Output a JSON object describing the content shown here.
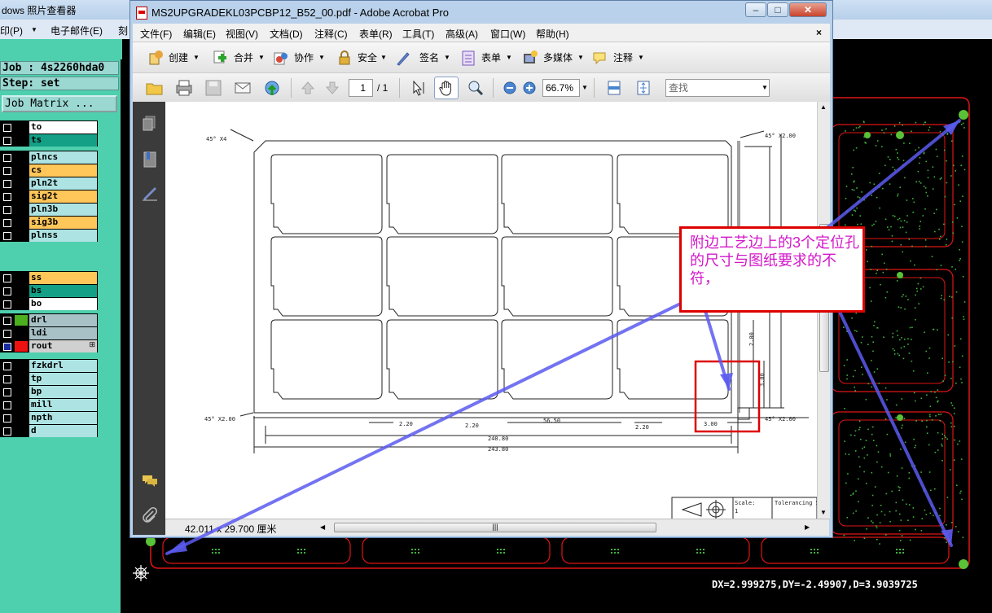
{
  "photo_viewer": {
    "title": "dows 照片查看器",
    "menu": [
      {
        "label": "打印(P)",
        "display": "印(P)"
      },
      {
        "label": "电子邮件(E)"
      },
      {
        "label": "刻"
      }
    ]
  },
  "cam": {
    "job": "Job : 4s2260hda0",
    "step": "Step: set",
    "job_matrix": "Job Matrix ...",
    "layer_groups": [
      [
        {
          "name": "to",
          "color": "white"
        },
        {
          "name": "ts",
          "color": "teal"
        }
      ],
      [
        {
          "name": "plncs",
          "color": "cyan"
        },
        {
          "name": "cs",
          "color": "orange"
        },
        {
          "name": "pln2t",
          "color": "cyan"
        },
        {
          "name": "sig2t",
          "color": "orange"
        },
        {
          "name": "pln3b",
          "color": "cyan"
        },
        {
          "name": "sig3b",
          "color": "orange"
        },
        {
          "name": "plnss",
          "color": "cyan"
        }
      ],
      [
        {
          "name": "ss",
          "color": "orange"
        },
        {
          "name": "bs",
          "color": "teal"
        },
        {
          "name": "bo",
          "color": "white"
        }
      ],
      [
        {
          "name": "drl",
          "color": "grey",
          "swatch": "#4caf1f"
        },
        {
          "name": "ldi",
          "color": "grey"
        },
        {
          "name": "rout",
          "color": "lgrey",
          "swatch": "#ee1111",
          "active": true,
          "extra": "⊞"
        }
      ],
      [
        {
          "name": "fzkdrl",
          "color": "cyan"
        },
        {
          "name": "tp",
          "color": "cyan"
        },
        {
          "name": "bp",
          "color": "cyan"
        },
        {
          "name": "mill",
          "color": "cyan"
        },
        {
          "name": "npth",
          "color": "cyan"
        },
        {
          "name": "d",
          "color": "cyan"
        }
      ]
    ],
    "status": "DX=2.999275,DY=-2.49907,D=3.9039725"
  },
  "acrobat": {
    "title": "MS2UPGRADEKL03PCBP12_B52_00.pdf - Adobe Acrobat Pro",
    "menu": [
      "文件(F)",
      "编辑(E)",
      "视图(V)",
      "文档(D)",
      "注释(C)",
      "表单(R)",
      "工具(T)",
      "高级(A)",
      "窗口(W)",
      "帮助(H)"
    ],
    "close_doc": "×",
    "toolbar": [
      {
        "label": "创建",
        "icon": "create-icon"
      },
      {
        "label": "合并",
        "icon": "combine-icon"
      },
      {
        "label": "协作",
        "icon": "collaborate-icon"
      },
      {
        "label": "安全",
        "icon": "lock-icon"
      },
      {
        "label": "签名",
        "icon": "pen-icon"
      },
      {
        "label": "表单",
        "icon": "form-icon"
      },
      {
        "label": "多媒体",
        "icon": "multimedia-icon"
      },
      {
        "label": "注释",
        "icon": "comment-icon"
      }
    ],
    "page_current": "1",
    "page_total": "/ 1",
    "zoom": "66.7%",
    "search_placeholder": "查找",
    "page_size": "42.011 x 29.700 厘米"
  },
  "drawing": {
    "chamfer_tl": "45° X4",
    "chamfer_tr": "45° X2.00",
    "chamfer_bl": "45° X2.00",
    "chamfer_br": "45° X2.00",
    "dim_2_20_a": "2.20",
    "dim_2_20_b": "2.20",
    "dim_2_20_c": "2.20",
    "dim_56_50": "56.50",
    "dim_240_80": "240.80",
    "dim_243_80": "243.80",
    "dim_3_00_h": "3.00",
    "dim_3_00_v": "3.00",
    "dim_2_00": "2.00",
    "scale_label": "Scale:",
    "scale_value": "1",
    "tolerance_label": "Tolerancing Standard :"
  },
  "annotation": {
    "text": "附边工艺边上的3个定位孔的尺寸与图纸要求的不符，"
  }
}
